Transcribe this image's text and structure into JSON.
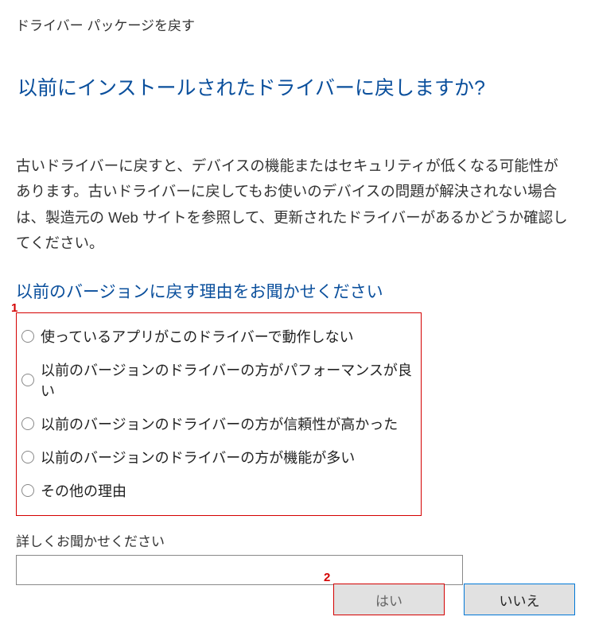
{
  "window_title": "ドライバー パッケージを戻す",
  "main_heading": "以前にインストールされたドライバーに戻しますか?",
  "description": "古いドライバーに戻すと、デバイスの機能またはセキュリティが低くなる可能性があります。古いドライバーに戻してもお使いのデバイスの問題が解決されない場合は、製造元の Web サイトを参照して、更新されたドライバーがあるかどうか確認してください。",
  "sub_heading": "以前のバージョンに戻す理由をお聞かせください",
  "reasons": {
    "items": [
      {
        "label": "使っているアプリがこのドライバーで動作しない"
      },
      {
        "label": "以前のバージョンのドライバーの方がパフォーマンスが良い"
      },
      {
        "label": "以前のバージョンのドライバーの方が信頼性が高かった"
      },
      {
        "label": "以前のバージョンのドライバーの方が機能が多い"
      },
      {
        "label": "その他の理由"
      }
    ]
  },
  "details_label": "詳しくお聞かせください",
  "buttons": {
    "yes": "はい",
    "no": "いいえ"
  },
  "annotations": {
    "one": "1",
    "two": "2"
  }
}
